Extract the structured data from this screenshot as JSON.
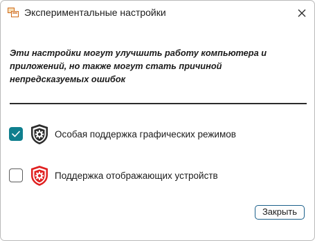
{
  "window": {
    "title": "Экспериментальные настройки"
  },
  "warning": {
    "text": "Эти настройки могут улучшить работу компьютера и приложений, но также могут стать причиной непредсказуемых ошибок"
  },
  "options": [
    {
      "label": "Особая поддержка графических режимов",
      "checked": true,
      "icon": "shield-gear-icon",
      "icon_color": "#2b2b2b"
    },
    {
      "label": "Поддержка отображающих устройств",
      "checked": false,
      "icon": "shield-gear-icon",
      "icon_color": "#e02020"
    }
  ],
  "buttons": {
    "close_label": "Закрыть"
  },
  "colors": {
    "accent": "#0f7f8e",
    "warning_red": "#e02020",
    "button_border": "#1a5f8a"
  }
}
